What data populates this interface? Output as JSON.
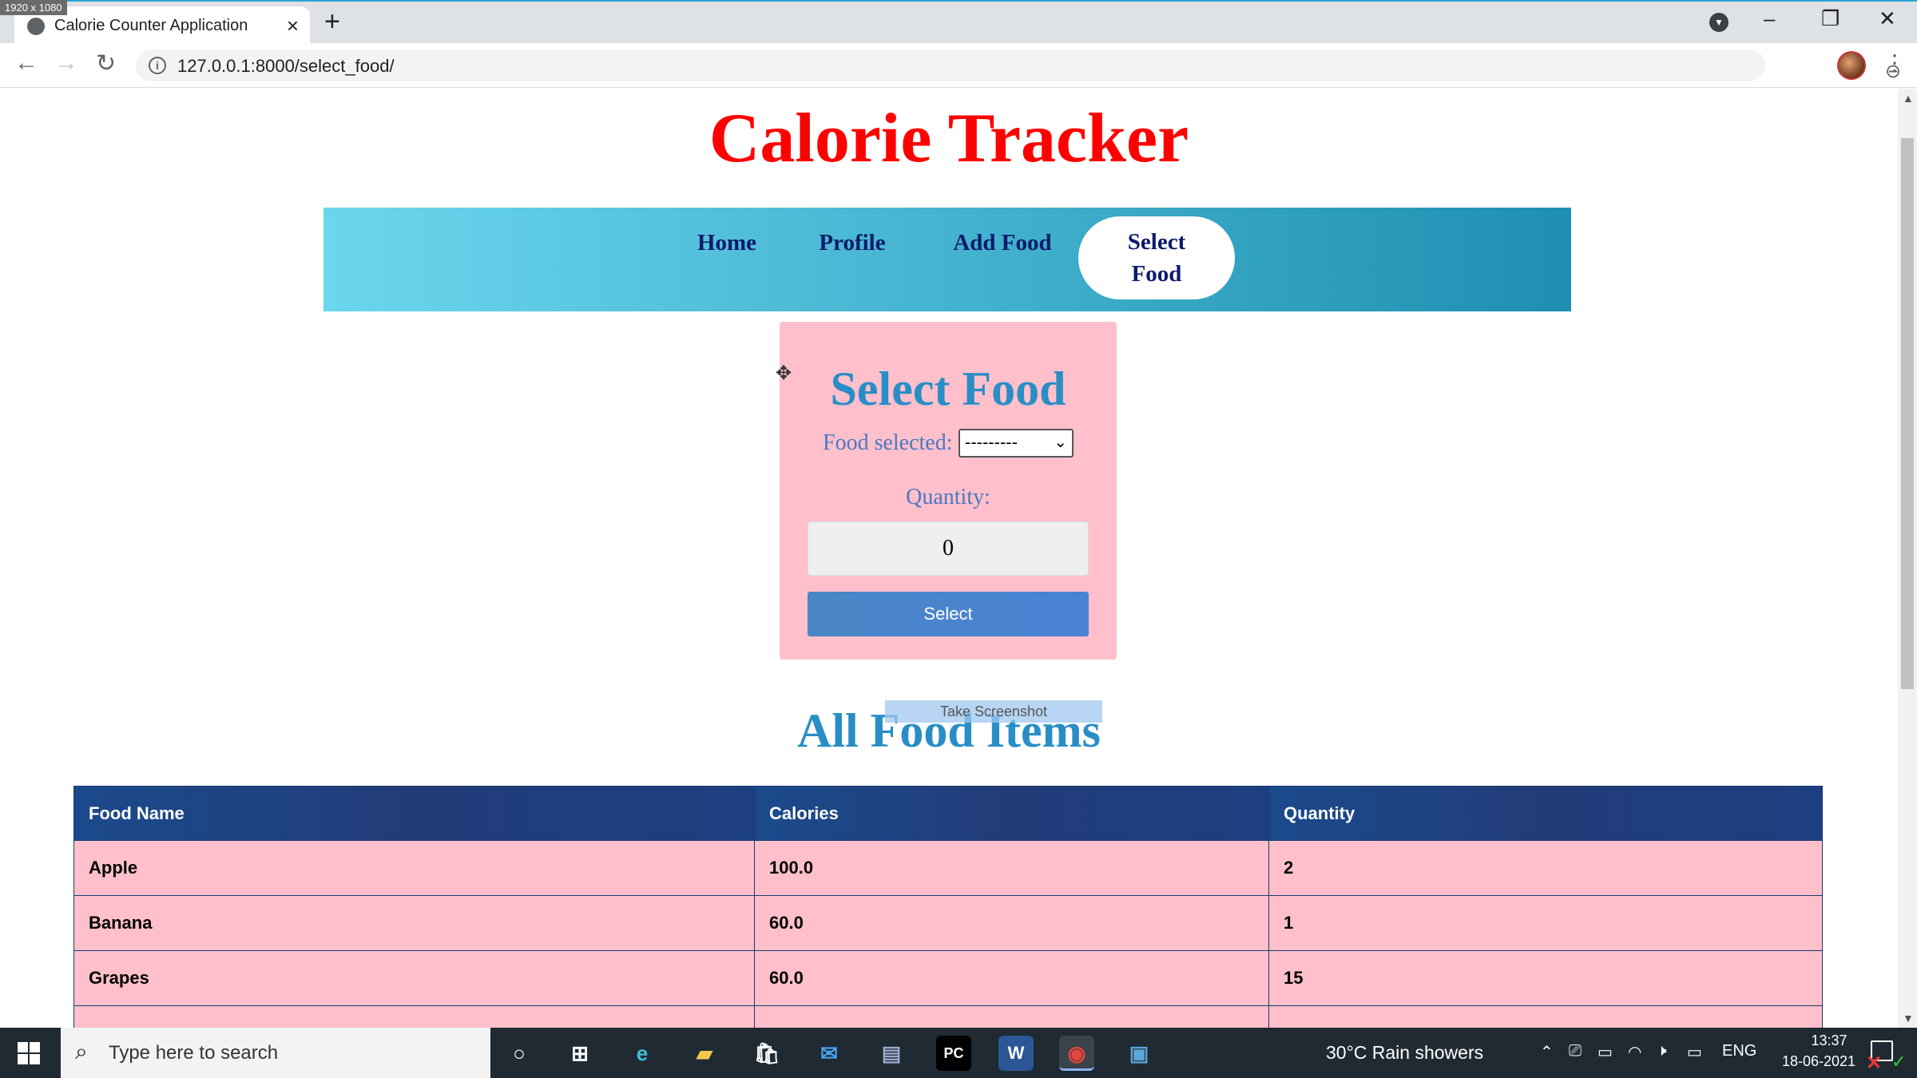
{
  "overlay": {
    "resolution_badge": "1920 x 1080"
  },
  "browser": {
    "tab_title": "Calorie Counter Application",
    "url": "127.0.0.1:8000/select_food/"
  },
  "page": {
    "title": "Calorie Tracker",
    "nav": [
      {
        "label": "Home"
      },
      {
        "label": "Profile"
      },
      {
        "label": "Add Food"
      },
      {
        "label_line1": "Select",
        "label_line2": "Food",
        "active": true
      }
    ],
    "form": {
      "heading": "Select Food",
      "food_label": "Food selected:",
      "food_value": "---------",
      "quantity_label": "Quantity:",
      "quantity_value": "0",
      "submit_label": "Select"
    },
    "screenshot_overlay": "Take Screenshot",
    "table_title": "All Food Items",
    "table": {
      "headers": [
        "Food Name",
        "Calories",
        "Quantity"
      ],
      "rows": [
        [
          "Apple",
          "100.0",
          "2"
        ],
        [
          "Banana",
          "60.0",
          "1"
        ],
        [
          "Grapes",
          "60.0",
          "15"
        ]
      ]
    }
  },
  "taskbar": {
    "search_placeholder": "Type here to search",
    "weather": "30°C  Rain showers",
    "language": "ENG",
    "time": "13:37",
    "date": "18-06-2021"
  },
  "colors": {
    "title_red": "#ff0000",
    "nav_start": "#6bd7ee",
    "nav_end": "#1e8fb1",
    "card_pink": "#ffc0cb",
    "heading_blue": "#2a8ec6",
    "table_header": "#1b4a8c"
  }
}
